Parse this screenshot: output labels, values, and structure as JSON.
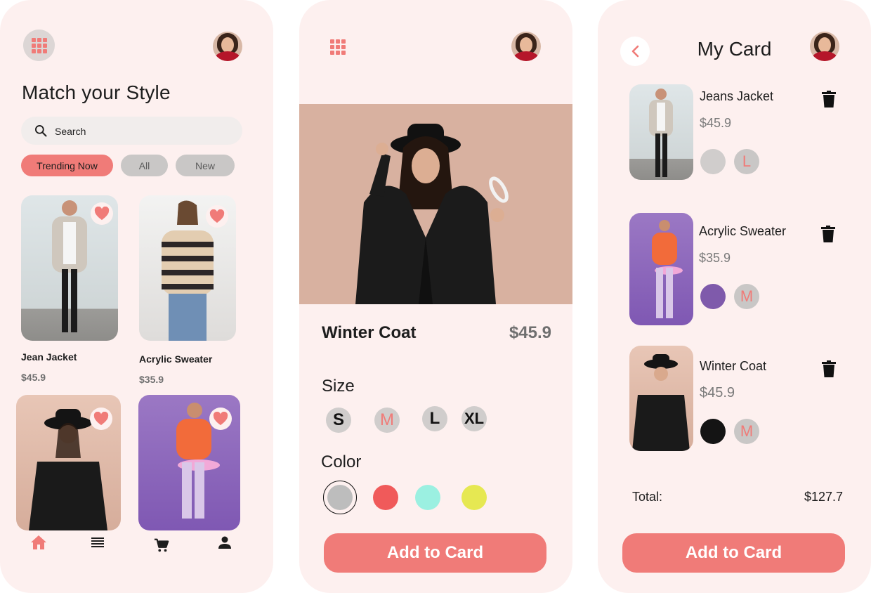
{
  "home": {
    "title": "Match your Style",
    "search": {
      "placeholder": "Search"
    },
    "filters": [
      {
        "label": "Trending Now",
        "active": true
      },
      {
        "label": "All",
        "active": false
      },
      {
        "label": "New",
        "active": false
      }
    ],
    "products": [
      {
        "name": "Jean Jacket",
        "price": "$45.9",
        "favorite": true
      },
      {
        "name": "Acrylic Sweater",
        "price": "$35.9",
        "favorite": true
      },
      {
        "name": "",
        "price": "",
        "favorite": true
      },
      {
        "name": "",
        "price": "",
        "favorite": true
      }
    ],
    "bottom_nav": [
      {
        "icon": "home-icon",
        "active": true
      },
      {
        "icon": "list-icon",
        "active": false
      },
      {
        "icon": "cart-icon",
        "active": false
      },
      {
        "icon": "profile-icon",
        "active": false
      }
    ]
  },
  "detail": {
    "product_name": "Winter Coat",
    "price": "$45.9",
    "size_label": "Size",
    "sizes": [
      "S",
      "M",
      "L",
      "XL"
    ],
    "selected_size": "M",
    "color_label": "Color",
    "colors": [
      "#bdbdbd",
      "#f05a5a",
      "#9bf0e1",
      "#e6e852"
    ],
    "selected_color": "#bdbdbd",
    "cta_label": "Add to Card"
  },
  "cart": {
    "title": "My Card",
    "items": [
      {
        "name": "Jeans Jacket",
        "price": "$45.9",
        "color": "#d0cdcc",
        "size": "L"
      },
      {
        "name": "Acrylic Sweater",
        "price": "$35.9",
        "color": "#7f5aab",
        "size": "M"
      },
      {
        "name": "Winter Coat",
        "price": "$45.9",
        "color": "#141414",
        "size": "M"
      }
    ],
    "total_label": "Total:",
    "total_value": "$127.7",
    "cta_label": "Add to Card"
  },
  "theme": {
    "accent": "#f07b78",
    "background": "#fdf0ef",
    "chip_inactive": "#c9c7c6"
  }
}
